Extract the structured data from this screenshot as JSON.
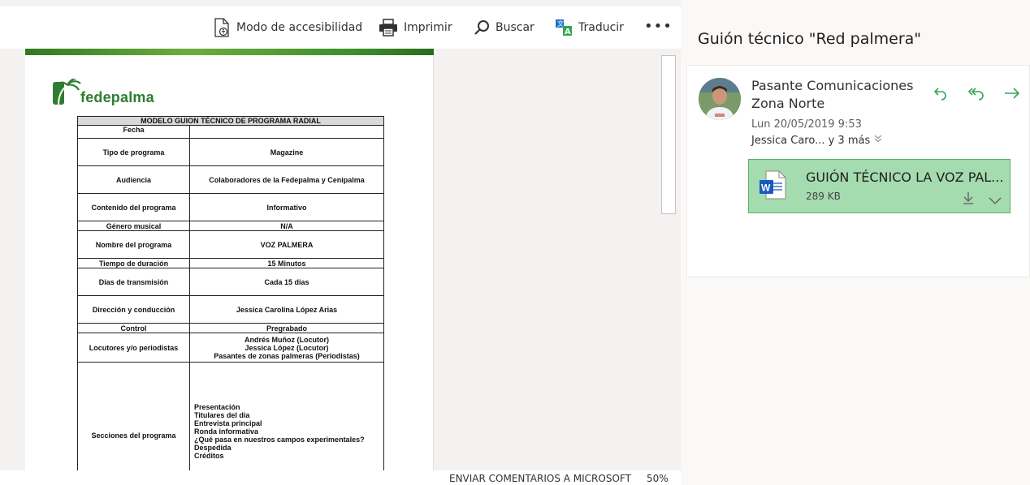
{
  "toolbar": {
    "accessibility_label": "Modo de accesibilidad",
    "print_label": "Imprimir",
    "search_label": "Buscar",
    "translate_label": "Traducir",
    "more_label": "•••"
  },
  "document": {
    "logo_text": "fedepalma",
    "table_title": "MODELO GUION TÉCNICO DE PROGRAMA RADIAL",
    "rows": [
      {
        "label": "Fecha",
        "value": ""
      },
      {
        "label": "Tipo de programa",
        "value": "Magazine"
      },
      {
        "label": "Audiencia",
        "value": "Colaboradores de la Fedepalma y Cenipalma"
      },
      {
        "label": "Contenido del programa",
        "value": "Informativo"
      },
      {
        "label": "Género musical",
        "value": "N/A"
      },
      {
        "label": "Nombre del programa",
        "value": "VOZ PALMERA"
      },
      {
        "label": "Tiempo de duración",
        "value": "15 Minutos"
      },
      {
        "label": "Dias de transmisión",
        "value": "Cada 15 dias"
      },
      {
        "label": "Dirección y conducción",
        "value": "Jessica Carolina López Arias"
      },
      {
        "label": "Control",
        "value": "Pregrabado"
      }
    ],
    "locutores_label": "Locutores y/o periodistas",
    "locutores": [
      "Andrés Muñoz (Locutor)",
      "Jessica López (Locutor)",
      "Pasantes de zonas palmeras (Periodistas)"
    ],
    "secciones_label": "Secciones del programa",
    "secciones": [
      "Presentación",
      "Titulares del dia",
      "Entrevista principal",
      "Ronda informativa",
      "¿Qué pasa en nuestros campos experimentales?",
      "Despedida",
      "Créditos"
    ]
  },
  "footer": {
    "feedback_label": "ENVIAR COMENTARIOS A MICROSOFT",
    "zoom": "50%"
  },
  "mail": {
    "subject": "Guión técnico \"Red palmera\"",
    "sender_line1": "Pasante Comunicaciones",
    "sender_line2": "Zona Norte",
    "date": "Lun 20/05/2019 9:53",
    "recipients": "Jessica Caro... y 3 más",
    "attachment": {
      "name": "GUIÓN TÉCNICO LA VOZ PAL...",
      "size": "289 KB"
    }
  },
  "colors": {
    "accent_green": "#33a650",
    "attachment_bg": "#a4dbaf",
    "word_blue": "#185abd"
  }
}
